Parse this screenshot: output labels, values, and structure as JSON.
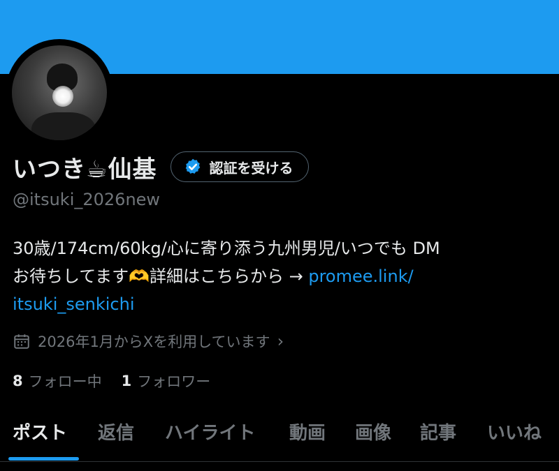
{
  "profile": {
    "display_name": "いつき☕仙基",
    "handle": "@itsuki_2026new",
    "verify_button_label": "認証を受ける",
    "bio_line1": "30歳/174cm/60kg/心に寄り添う九州男児/いつでも DM",
    "bio_line2_text": "お待ちしてます🫶詳細はこちらから → ",
    "bio_link_part1": "promee.link/",
    "bio_link_part2": "itsuki_senkichi",
    "joined": "2026年1月からXを利用しています",
    "following_count": "8",
    "following_label": "フォロー中",
    "followers_count": "1",
    "followers_label": "フォロワー"
  },
  "tabs": [
    {
      "label": "ポスト",
      "active": true
    },
    {
      "label": "返信",
      "active": false
    },
    {
      "label": "ハイライト",
      "active": false
    },
    {
      "label": "動画",
      "active": false
    },
    {
      "label": "画像",
      "active": false
    },
    {
      "label": "記事",
      "active": false
    },
    {
      "label": "いいね",
      "active": false
    }
  ],
  "colors": {
    "banner": "#1d9bf0",
    "accent": "#1d9bf0",
    "background": "#000000",
    "muted_text": "#71767b"
  },
  "icons": {
    "verify": "verified-badge-icon",
    "calendar": "calendar-icon",
    "chevron": "chevron-right-icon"
  }
}
